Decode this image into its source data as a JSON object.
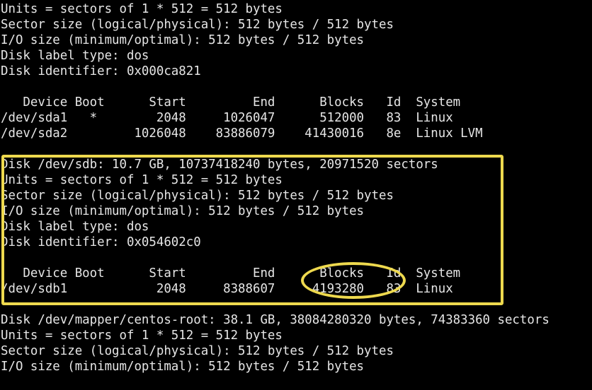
{
  "terminal": {
    "title": "fdisk -l output",
    "background_color": "#000000",
    "text_color": "#e6e6e6",
    "annotation_color": "#eed94e",
    "lines": [
      "Units = sectors of 1 * 512 = 512 bytes",
      "Sector size (logical/physical): 512 bytes / 512 bytes",
      "I/O size (minimum/optimal): 512 bytes / 512 bytes",
      "Disk label type: dos",
      "Disk identifier: 0x000ca821",
      "",
      "   Device Boot      Start         End      Blocks   Id  System",
      "/dev/sda1   *        2048     1026047      512000   83  Linux",
      "/dev/sda2         1026048    83886079    41430016   8e  Linux LVM",
      "",
      "Disk /dev/sdb: 10.7 GB, 10737418240 bytes, 20971520 sectors",
      "Units = sectors of 1 * 512 = 512 bytes",
      "Sector size (logical/physical): 512 bytes / 512 bytes",
      "I/O size (minimum/optimal): 512 bytes / 512 bytes",
      "Disk label type: dos",
      "Disk identifier: 0x054602c0",
      "",
      "   Device Boot      Start         End      Blocks   Id  System",
      "/dev/sdb1            2048     8388607     4193280   83  Linux",
      "",
      "Disk /dev/mapper/centos-root: 38.1 GB, 38084280320 bytes, 74383360 sectors",
      "Units = sectors of 1 * 512 = 512 bytes",
      "Sector size (logical/physical): 512 bytes / 512 bytes",
      "I/O size (minimum/optimal): 512 bytes / 512 bytes"
    ]
  },
  "disks": {
    "sda": {
      "units": "sectors of 1 * 512 = 512 bytes",
      "sector_size": "512 bytes / 512 bytes",
      "io_size": "512 bytes / 512 bytes",
      "label_type": "dos",
      "identifier": "0x000ca821",
      "table": {
        "headers": [
          "Device",
          "Boot",
          "Start",
          "End",
          "Blocks",
          "Id",
          "System"
        ],
        "rows": [
          [
            "/dev/sda1",
            "*",
            "2048",
            "1026047",
            "512000",
            "83",
            "Linux"
          ],
          [
            "/dev/sda2",
            "",
            "1026048",
            "83886079",
            "41430016",
            "8e",
            "Linux LVM"
          ]
        ]
      }
    },
    "sdb": {
      "summary": "Disk /dev/sdb: 10.7 GB, 10737418240 bytes, 20971520 sectors",
      "device": "/dev/sdb",
      "size_human": "10.7 GB",
      "size_bytes": "10737418240 bytes",
      "sectors": "20971520 sectors",
      "units": "sectors of 1 * 512 = 512 bytes",
      "sector_size": "512 bytes / 512 bytes",
      "io_size": "512 bytes / 512 bytes",
      "label_type": "dos",
      "identifier": "0x054602c0",
      "table": {
        "headers": [
          "Device",
          "Boot",
          "Start",
          "End",
          "Blocks",
          "Id",
          "System"
        ],
        "rows": [
          [
            "/dev/sdb1",
            "",
            "2048",
            "8388607",
            "4193280",
            "83",
            "Linux"
          ]
        ]
      }
    },
    "centos_root": {
      "summary": "Disk /dev/mapper/centos-root: 38.1 GB, 38084280320 bytes, 74383360 sectors",
      "device": "/dev/mapper/centos-root",
      "size_human": "38.1 GB",
      "size_bytes": "38084280320 bytes",
      "sectors": "74383360 sectors",
      "units": "sectors of 1 * 512 = 512 bytes",
      "sector_size": "512 bytes / 512 bytes",
      "io_size": "512 bytes / 512 bytes"
    }
  },
  "annotations": {
    "box": {
      "shape": "rectangle",
      "color": "#eed94e",
      "encloses": "Disk /dev/sdb section"
    },
    "ellipse": {
      "shape": "ellipse",
      "color": "#eed94e",
      "encloses": "Blocks column value 4193280"
    }
  }
}
